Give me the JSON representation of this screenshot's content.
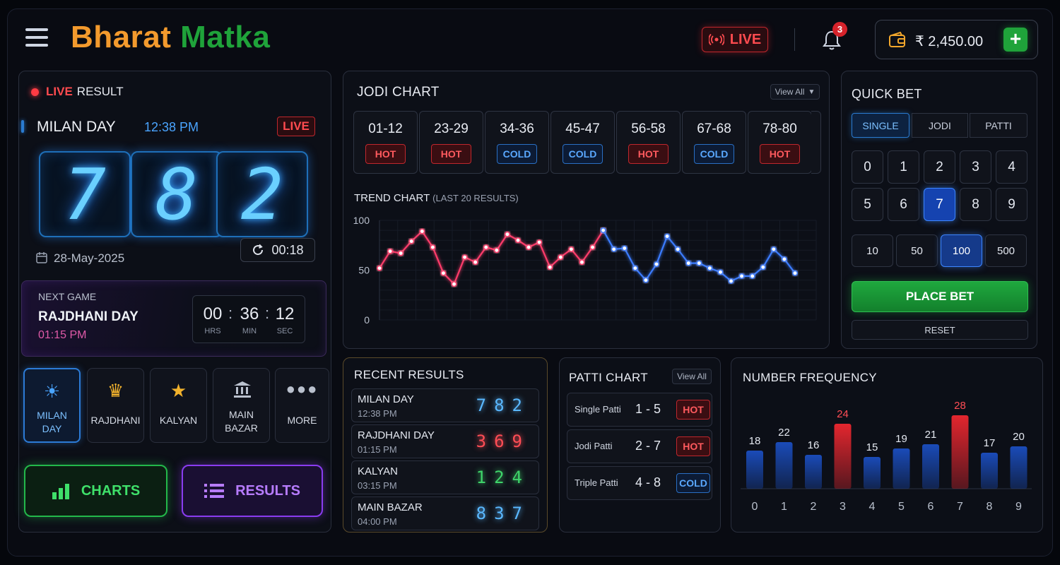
{
  "header": {
    "logo_part1": "Bharat",
    "logo_part2": "Matka",
    "live_label": "LIVE",
    "notification_count": "3",
    "wallet_balance": "₹ 2,450.00",
    "add_label": "+"
  },
  "live_result": {
    "live_word": "LIVE",
    "result_word": "RESULT",
    "game_name": "MILAN DAY",
    "game_time": "12:38 PM",
    "live_badge": "LIVE",
    "digits": [
      "7",
      "8",
      "2"
    ],
    "date": "28-May-2025",
    "refresh_timer": "00:18"
  },
  "next_game": {
    "label": "NEXT GAME",
    "name": "RAJDHANI DAY",
    "time": "01:15 PM",
    "hours": "00",
    "minutes": "36",
    "seconds": "12",
    "hrs_label": "HRS",
    "min_label": "MIN",
    "sec_label": "SEC"
  },
  "markets": [
    {
      "label": "MILAN\nDAY",
      "icon": "sun-icon"
    },
    {
      "label": "RAJDHANI",
      "icon": "crown-icon"
    },
    {
      "label": "KALYAN",
      "icon": "star-icon"
    },
    {
      "label": "MAIN\nBAZAR",
      "icon": "bank-icon"
    },
    {
      "label": "MORE",
      "icon": "more-dots-icon"
    }
  ],
  "actions": {
    "charts": "CHARTS",
    "results": "RESULTS"
  },
  "jodi_chart": {
    "title": "JODI CHART",
    "view_all": "View All",
    "cells": [
      {
        "range": "01-12",
        "status": "HOT"
      },
      {
        "range": "23-29",
        "status": "HOT"
      },
      {
        "range": "34-36",
        "status": "COLD"
      },
      {
        "range": "45-47",
        "status": "COLD"
      },
      {
        "range": "56-58",
        "status": "HOT"
      },
      {
        "range": "67-68",
        "status": "COLD"
      },
      {
        "range": "78-80",
        "status": "HOT"
      }
    ]
  },
  "trend": {
    "title": "TREND CHART",
    "subtitle": "(LAST 20 RESULTS)"
  },
  "chart_data": [
    {
      "type": "line",
      "title": "TREND CHART",
      "subtitle": "(LAST 20 RESULTS)",
      "ylim": [
        0,
        100
      ],
      "yticks": [
        0,
        50,
        100
      ],
      "series": [
        {
          "color": "#ff3b6a",
          "values": [
            52,
            69,
            67,
            79,
            89,
            73,
            47,
            36,
            63,
            58,
            73,
            70,
            86,
            80,
            73,
            78,
            53,
            63,
            71,
            58,
            73,
            90
          ]
        },
        {
          "color": "#3a7bff",
          "values": [
            90,
            71,
            72,
            52,
            40,
            56,
            84,
            71,
            57,
            57,
            52,
            48,
            39,
            44,
            44,
            53,
            71,
            61,
            47
          ]
        }
      ],
      "grid": true
    },
    {
      "type": "bar",
      "title": "NUMBER FREQUENCY",
      "categories": [
        "0",
        "1",
        "2",
        "3",
        "4",
        "5",
        "6",
        "7",
        "8",
        "9"
      ],
      "values": [
        18,
        22,
        16,
        24,
        15,
        19,
        21,
        28,
        17,
        20
      ],
      "highlight": [
        "3",
        "7"
      ],
      "colors": {
        "normal": "#1a4bb8",
        "highlight": "#e3262e"
      }
    }
  ],
  "quick_bet": {
    "title": "QUICK BET",
    "tabs": [
      "SINGLE",
      "JODI",
      "PATTI"
    ],
    "numbers": [
      "0",
      "1",
      "2",
      "3",
      "4",
      "5",
      "6",
      "7",
      "8",
      "9"
    ],
    "selected_number": "7",
    "amounts": [
      "10",
      "50",
      "100",
      "500"
    ],
    "selected_amount": "100",
    "place_bet": "PLACE BET",
    "reset": "RESET"
  },
  "recent_results": {
    "title": "RECENT RESULTS",
    "rows": [
      {
        "name": "MILAN DAY",
        "time": "12:38 PM",
        "digits": "782",
        "color": "#5ab8ff"
      },
      {
        "name": "RAJDHANI DAY",
        "time": "01:15 PM",
        "digits": "369",
        "color": "#ff4d55"
      },
      {
        "name": "KALYAN",
        "time": "03:15 PM",
        "digits": "124",
        "color": "#3fd46a"
      },
      {
        "name": "MAIN BAZAR",
        "time": "04:00 PM",
        "digits": "837",
        "color": "#5ab8ff"
      }
    ]
  },
  "patti_chart": {
    "title": "PATTI CHART",
    "view_all": "View All",
    "rows": [
      {
        "name": "Single Patti",
        "range": "1 - 5",
        "status": "HOT"
      },
      {
        "name": "Jodi Patti",
        "range": "2 - 7",
        "status": "HOT"
      },
      {
        "name": "Triple Patti",
        "range": "4 - 8",
        "status": "COLD"
      }
    ]
  },
  "number_frequency": {
    "title": "NUMBER FREQUENCY"
  }
}
